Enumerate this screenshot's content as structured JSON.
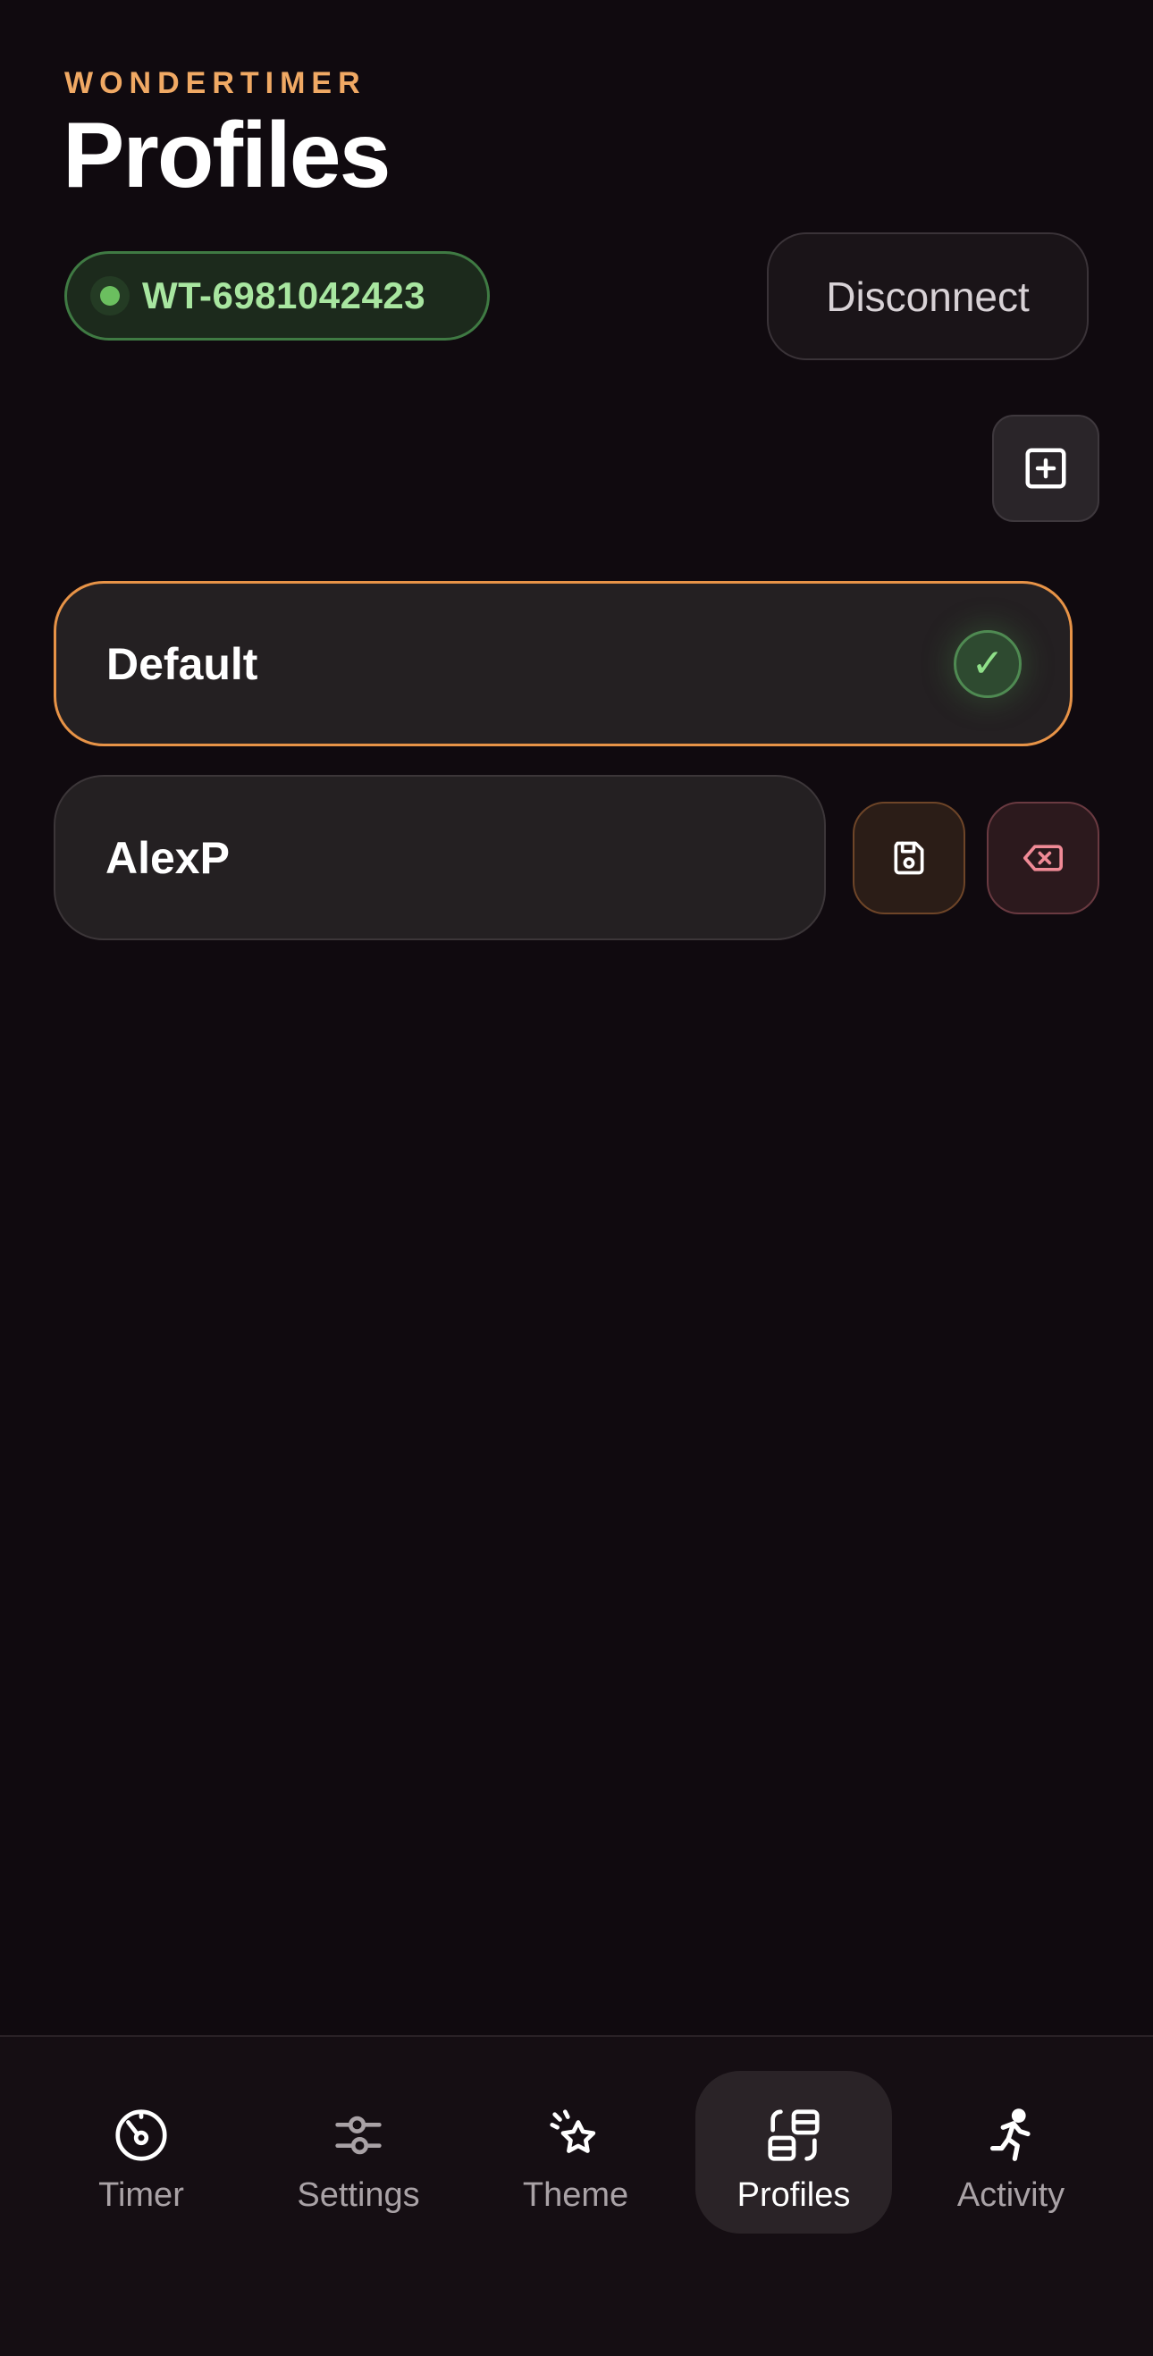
{
  "header": {
    "brand": "WONDERTIMER",
    "title": "Profiles"
  },
  "device": {
    "id": "WT-6981042423",
    "status": "connected",
    "status_color": "#6bbf5f"
  },
  "actions": {
    "disconnect_label": "Disconnect",
    "add_icon": "plus-square-icon"
  },
  "profiles": [
    {
      "name": "Default",
      "active": true,
      "active_icon": "check-circle-icon"
    },
    {
      "name": "AlexP",
      "active": false,
      "save_icon": "floppy-disk-icon",
      "delete_icon": "backspace-x-icon"
    }
  ],
  "nav": {
    "items": [
      {
        "label": "Timer",
        "icon": "timer-dial-icon",
        "active": false
      },
      {
        "label": "Settings",
        "icon": "sliders-icon",
        "active": false
      },
      {
        "label": "Theme",
        "icon": "sparkle-star-icon",
        "active": false
      },
      {
        "label": "Profiles",
        "icon": "profiles-layout-icon",
        "active": true
      },
      {
        "label": "Activity",
        "icon": "running-person-icon",
        "active": false
      }
    ]
  },
  "colors": {
    "accent": "#f0a964",
    "active_border": "#e79347",
    "background": "#100a0f",
    "success": "#8fe089",
    "danger": "#f08a96"
  }
}
